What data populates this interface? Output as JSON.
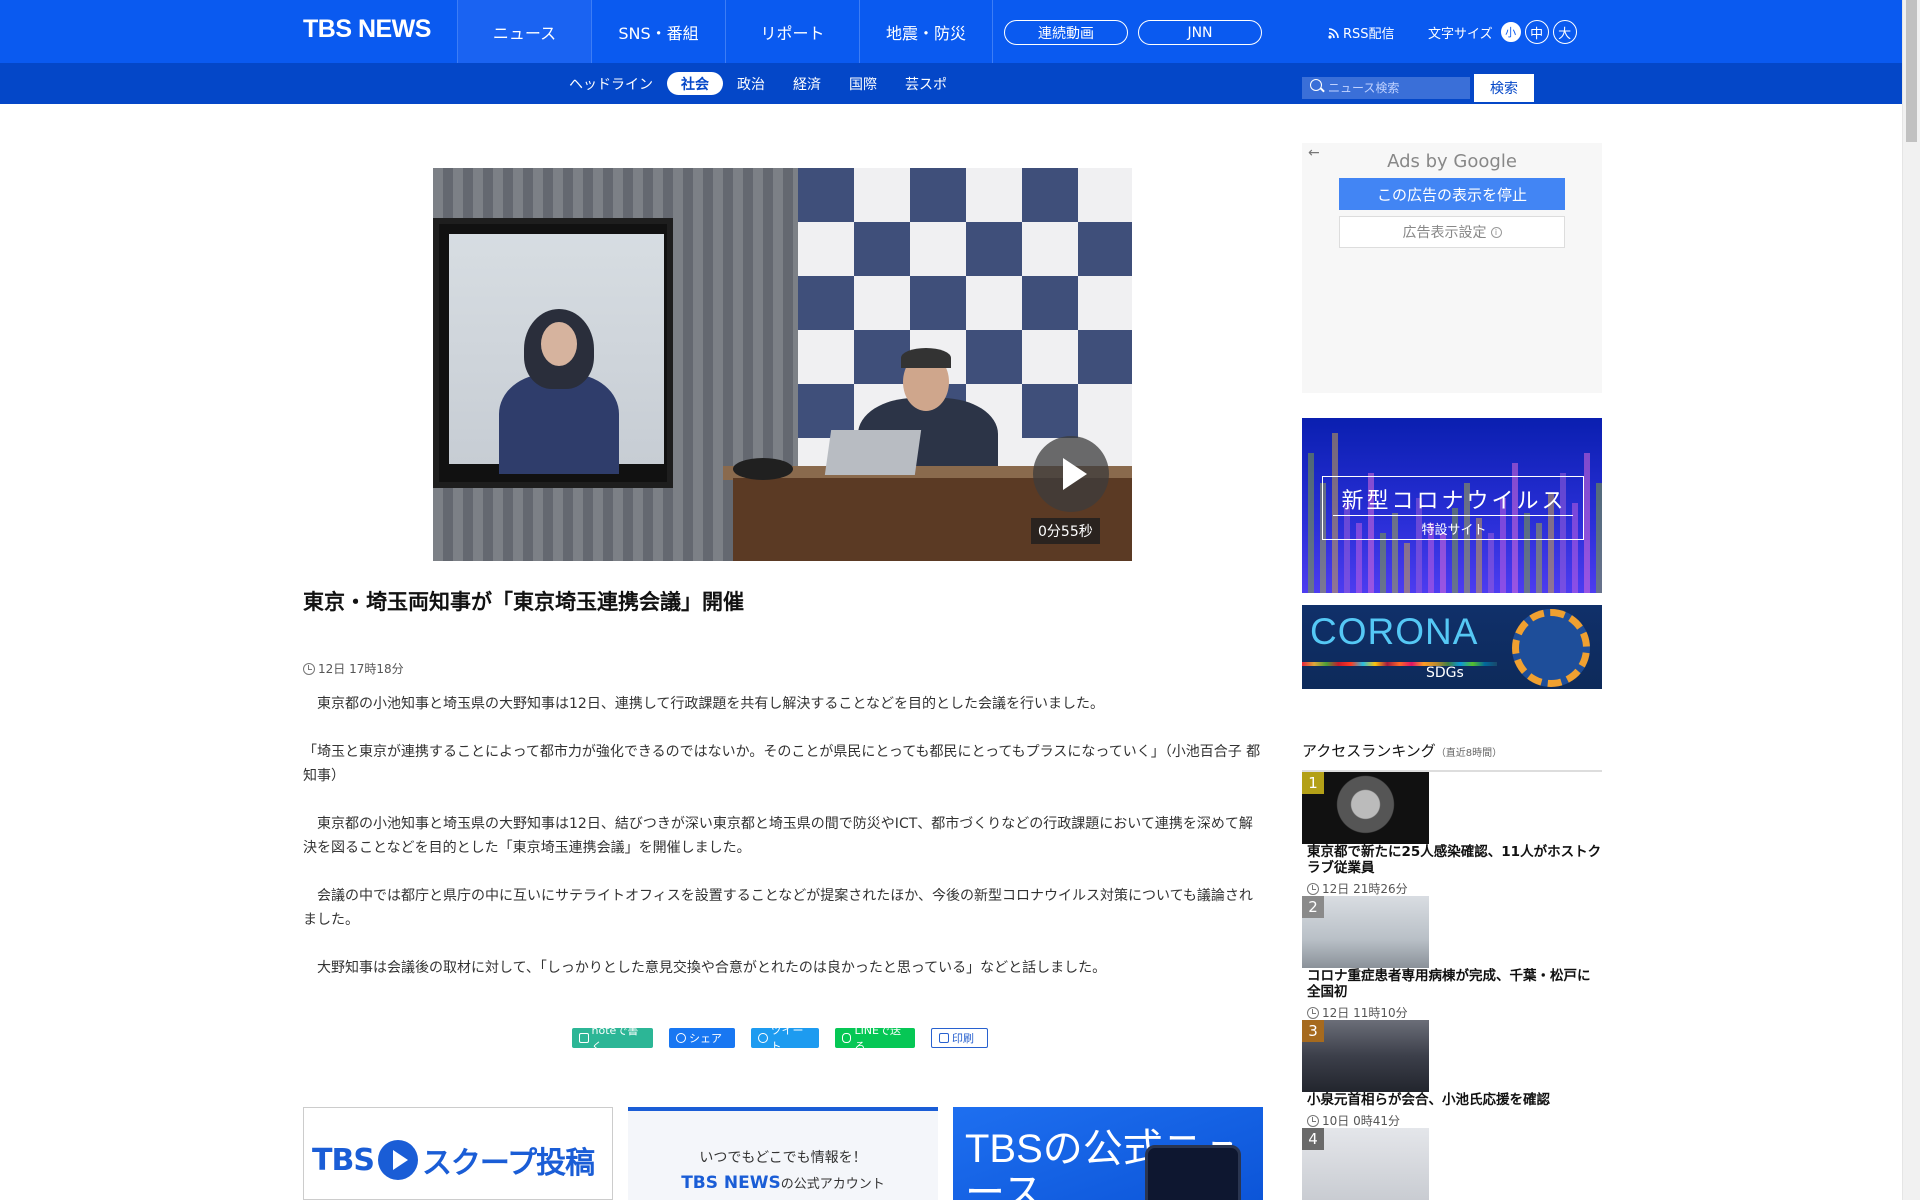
{
  "header": {
    "logo": "TBS NEWS",
    "nav": [
      {
        "label": "ニュース",
        "active": true
      },
      {
        "label": "SNS・番組",
        "active": false
      },
      {
        "label": "リポート",
        "active": false
      },
      {
        "label": "地震・防災",
        "active": false
      }
    ],
    "pill_buttons": [
      "連続動画",
      "JNN"
    ],
    "rss_label": "RSS配信",
    "fontsize_label": "文字サイズ",
    "fontsize_options": [
      "小",
      "中",
      "大"
    ]
  },
  "subnav": {
    "items": [
      {
        "label": "ヘッドライン",
        "active": false
      },
      {
        "label": "社会",
        "active": true
      },
      {
        "label": "政治",
        "active": false
      },
      {
        "label": "経済",
        "active": false
      },
      {
        "label": "国際",
        "active": false
      },
      {
        "label": "芸スポ",
        "active": false
      }
    ],
    "search_placeholder": "ニュース検索",
    "search_button": "検索"
  },
  "article": {
    "video_duration": "0分55秒",
    "title": "東京・埼玉両知事が「東京埼玉連携会議」開催",
    "date": "12日 17時18分",
    "paragraphs": [
      "　東京都の小池知事と埼玉県の大野知事は12日、連携して行政課題を共有し解決することなどを目的とした会議を行いました。",
      "「埼玉と東京が連携することによって都市力が強化できるのではないか。そのことが県民にとっても都民にとってもプラスになっていく」（小池百合子 都知事）",
      "　東京都の小池知事と埼玉県の大野知事は12日、結びつきが深い東京都と埼玉県の間で防災やICT、都市づくりなどの行政課題において連携を深めて解決を図ることなどを目的とした「東京埼玉連携会議」を開催しました。",
      "　会議の中では都庁と県庁の中に互いにサテライトオフィスを設置することなどが提案されたほか、今後の新型コロナウイルス対策についても議論されました。",
      "　大野知事は会議後の取材に対して、「しっかりとした意見交換や合意がとれたのは良かったと思っている」などと話しました。"
    ],
    "share": {
      "note": "noteで書く",
      "facebook": "シェア",
      "twitter": "ツイート",
      "line": "LINEで送る",
      "print": "印刷"
    }
  },
  "bottom_banners": {
    "scoop": "スクープ投稿",
    "scoop_brand": "TBS",
    "official_line1": "いつでもどこでも情報を！",
    "official_line2": "TBS NEWS",
    "official_line2_suffix": "の公式アカウント",
    "app_text": "TBSの公式ニュース"
  },
  "sidebar": {
    "ad": {
      "ads_by": "Ads by Google",
      "stop": "この広告の表示を停止",
      "settings": "広告表示設定"
    },
    "corona_banner": {
      "title": "新型コロナウイルス",
      "subtitle": "特設サイト"
    },
    "sdgs_banner": {
      "title": "CORONA",
      "subtitle": "SDGs"
    },
    "ranking": {
      "title": "アクセスランキング",
      "period": "（直近8時間）",
      "items": [
        {
          "rank": "1",
          "title": "東京都で新たに25人感染確認、11人がホストクラブ従業員",
          "date": "12日 21時26分",
          "color": "#b3a017"
        },
        {
          "rank": "2",
          "title": "コロナ重症患者専用病棟が完成、千葉・松戸に全国初",
          "date": "12日 11時10分",
          "color": "#8a8a8a"
        },
        {
          "rank": "3",
          "title": "小泉元首相らが会合、小池氏応援を確認",
          "date": "10日 0時41分",
          "color": "#a66a1e"
        },
        {
          "rank": "4",
          "title": "",
          "date": "",
          "color": "#6a6a6a"
        }
      ]
    }
  },
  "colors": {
    "brand_blue": "#0a5af0",
    "subnav_blue": "#0447c8",
    "ad_blue": "#4285f4"
  }
}
